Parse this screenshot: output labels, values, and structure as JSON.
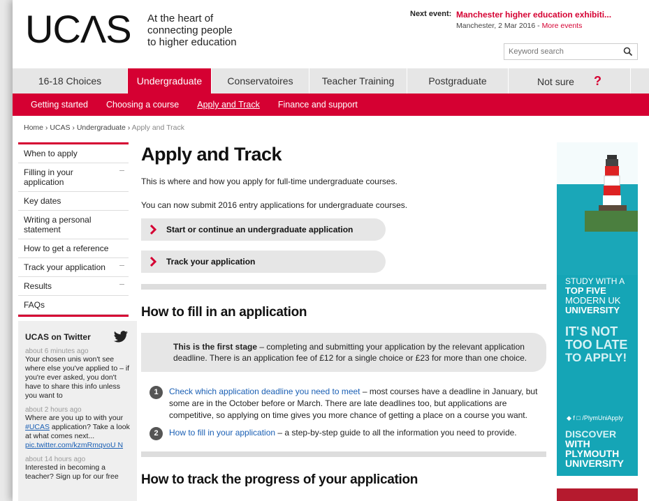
{
  "header": {
    "logo": "UCΛS",
    "tagline": [
      "At the heart of",
      "connecting people",
      "to higher education"
    ],
    "next_event_label": "Next event:",
    "next_event_title": "Manchester higher education exhibiti...",
    "next_event_sub": "Manchester, 2 Mar 2016 - ",
    "more_events": "More events",
    "search_placeholder": "Keyword search"
  },
  "topnav": [
    {
      "label": "16-18 Choices",
      "active": false,
      "width": 165
    },
    {
      "label": "Undergraduate",
      "active": true,
      "width": 120
    },
    {
      "label": "Conservatoires",
      "active": false,
      "width": 140
    },
    {
      "label": "Teacher Training",
      "active": false,
      "width": 140
    },
    {
      "label": "Postgraduate",
      "active": false,
      "width": 145
    },
    {
      "label": "Not sure",
      "active": false,
      "width": 175
    }
  ],
  "help_label": "?",
  "subnav": [
    {
      "label": "Getting started",
      "current": false
    },
    {
      "label": "Choosing a course",
      "current": false
    },
    {
      "label": "Apply and Track",
      "current": true
    },
    {
      "label": "Finance and support",
      "current": false
    }
  ],
  "breadcrumb": {
    "path": "Home › UCAS › Undergraduate › ",
    "last": "Apply and Track"
  },
  "sidenav": [
    {
      "label": "When to apply",
      "caret": false
    },
    {
      "label": "Filling in your application",
      "caret": true
    },
    {
      "label": "Key dates",
      "caret": false
    },
    {
      "label": "Writing a personal statement",
      "caret": false
    },
    {
      "label": "How to get a reference",
      "caret": false
    },
    {
      "label": "Track your application",
      "caret": true
    },
    {
      "label": "Results",
      "caret": true
    },
    {
      "label": "FAQs",
      "caret": false
    }
  ],
  "twitter": {
    "heading": "UCAS on Twitter",
    "tweets": [
      {
        "time": "about 6 minutes ago",
        "text": "Your chosen unis won't see where else you've applied to – if you're ever asked, you don't have to share this info unless you want to"
      },
      {
        "time": "about 2 hours ago",
        "text_before": "Where are you up to with your ",
        "hashtag": "#UCAS",
        "text_after": " application? Take a look at what comes next...",
        "link": "pic.twitter.com/kzmRmqvoU N"
      },
      {
        "time": "about 14 hours ago",
        "text": "Interested in becoming a teacher? Sign up for our free"
      }
    ]
  },
  "main": {
    "title": "Apply and Track",
    "intro": "This is where and how you apply for full-time undergraduate courses.",
    "intro2": "You can now submit 2016 entry applications for undergraduate courses.",
    "cta1": "Start or continue an undergraduate application",
    "cta2": "Track your application",
    "h2_fill": "How to fill in an application",
    "first_stage_bold": "This is the first stage",
    "first_stage_text": " – completing and submitting your application by the relevant application deadline. There is an application fee of £12 for a single choice or £23 for more than one choice.",
    "step1_link": "Check which application deadline you need to meet",
    "step1_text": " – most courses have a deadline in January, but some are in the October before or March. There are late deadlines too, but applications are competitive, so applying on time gives you more chance of getting a place on a course you want.",
    "step2_link": "How to fill in your application",
    "step2_text": " – a step-by-step guide to all the information you need to provide.",
    "h2_track": "How to track the progress of your application"
  },
  "ad": {
    "line1": "STUDY WITH A",
    "line2": "TOP FIVE",
    "line3": "MODERN UK",
    "line4": "UNIVERSITY",
    "line5": "IT'S NOT",
    "line6": "TOO LATE",
    "line7": "TO APPLY!",
    "social": "/PlymUniApply",
    "line8": "DISCOVER",
    "line9": "WITH",
    "line10": "PLYMOUTH",
    "line11": "UNIVERSITY"
  },
  "colors": {
    "brand": "#d50032",
    "ad_teal": "#15a5b6",
    "link": "#1a5fb4"
  }
}
